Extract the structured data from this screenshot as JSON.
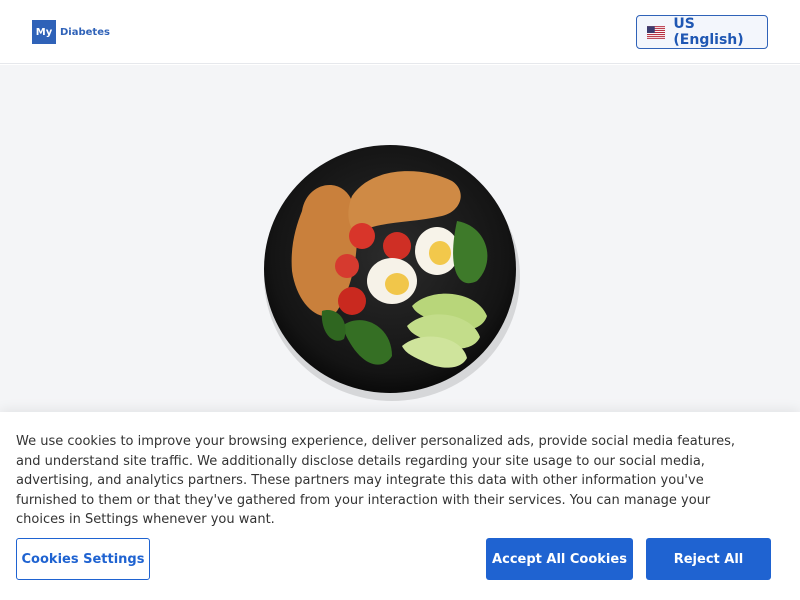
{
  "header": {
    "logo": {
      "box_text": "My",
      "text": "Diabetes"
    },
    "language_button": {
      "label": "US (English)",
      "flag_icon": "us-flag-icon"
    }
  },
  "hero": {
    "image": "plate-of-chicken-eggs-tomatoes-spinach-apple-slices"
  },
  "cookie_banner": {
    "text": "We use cookies to improve your browsing experience, deliver personalized ads, provide social media features, and understand site traffic. We additionally disclose details regarding your site usage to our social media, advertising, and analytics partners. These partners may integrate this data with other information you've furnished to them or that they've gathered from your interaction with their services. You can manage your choices in Settings whenever you want.",
    "settings_label": "Cookies Settings",
    "accept_label": "Accept All Cookies",
    "reject_label": "Reject All"
  },
  "colors": {
    "brand_blue": "#2f62b8",
    "button_blue": "#1f63d1",
    "hero_bg": "#f4f5f7"
  }
}
